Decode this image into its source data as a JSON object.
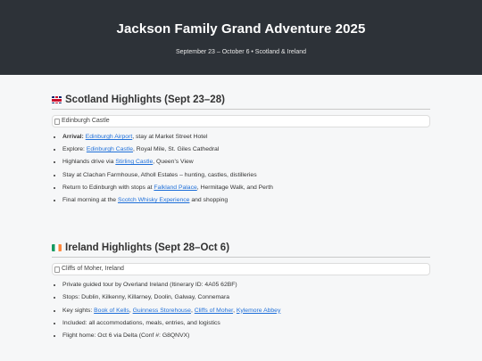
{
  "header": {
    "title": "Jackson Family Grand Adventure 2025",
    "subtitle": "September 23 – October 6 • Scotland & Ireland"
  },
  "scotland": {
    "heading": "Scotland Highlights (Sept 23–28)",
    "image_alt": "Edinburgh Castle",
    "items": {
      "i1": {
        "label": "Arrival:",
        "pre": " ",
        "link": "Edinburgh Airport",
        "post": ", stay at Market Street Hotel"
      },
      "i2": {
        "pre": "Explore: ",
        "link": "Edinburgh Castle",
        "post": ", Royal Mile, St. Giles Cathedral"
      },
      "i3": {
        "pre": "Highlands drive via ",
        "link": "Stirling Castle",
        "post": ", Queen's View"
      },
      "i4": {
        "text": "Stay at Clachan Farmhouse, Atholl Estates – hunting, castles, distilleries"
      },
      "i5": {
        "pre": "Return to Edinburgh with stops at ",
        "link": "Falkland Palace",
        "post": ", Hermitage Walk, and Perth"
      },
      "i6": {
        "pre": "Final morning at the ",
        "link": "Scotch Whisky Experience",
        "post": " and shopping"
      }
    }
  },
  "ireland": {
    "heading": "Ireland Highlights (Sept 28–Oct 6)",
    "image_alt": "Cliffs of Moher, Ireland",
    "items": {
      "i1": {
        "text": "Private guided tour by Overland Ireland (Itinerary ID: 4A05 62BF)"
      },
      "i2": {
        "text": "Stops: Dublin, Kilkenny, Killarney, Doolin, Galway, Connemara"
      },
      "i3": {
        "pre": "Key sights: ",
        "l1": "Book of Kells",
        "s1": ", ",
        "l2": "Guinness Storehouse",
        "s2": ", ",
        "l3": "Cliffs of Moher",
        "s3": ", ",
        "l4": "Kylemore Abbey"
      },
      "i4": {
        "text": "Included: all accommodations, meals, entries, and logistics"
      },
      "i5": {
        "text": "Flight home: Oct 6 via Delta (Conf #: G8QNVX)"
      }
    }
  }
}
